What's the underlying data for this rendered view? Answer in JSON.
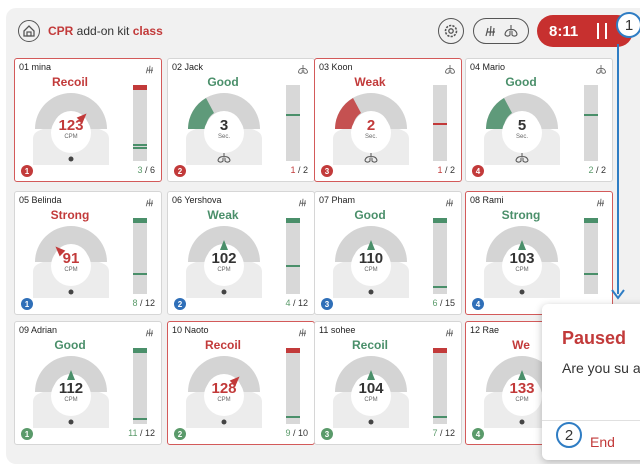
{
  "header": {
    "brand": "CPR",
    "title_mid": " add-on kit ",
    "title_class": "class",
    "timer": "8:11",
    "accent": "#c7302f"
  },
  "markers": {
    "m1": "1",
    "m2": "2"
  },
  "dialog": {
    "title": "Paused",
    "message": "Are you su and save t",
    "button": "End"
  },
  "cards": [
    {
      "name": "01 mina",
      "status": "Recoil",
      "value": "123",
      "unit": "CPM",
      "badge": "1",
      "count_a": "3",
      "count_b": "/ 6"
    },
    {
      "name": "02 Jack",
      "status": "Good",
      "value": "3",
      "unit": "Sec.",
      "badge": "2",
      "count_a": "1",
      "count_b": "/ 2"
    },
    {
      "name": "03 Koon",
      "status": "Weak",
      "value": "2",
      "unit": "Sec.",
      "badge": "3",
      "count_a": "1",
      "count_b": "/ 2"
    },
    {
      "name": "04 Mario",
      "status": "Good",
      "value": "5",
      "unit": "Sec.",
      "badge": "4",
      "count_a": "2",
      "count_b": "/ 2"
    },
    {
      "name": "05 Belinda",
      "status": "Strong",
      "value": "91",
      "unit": "CPM",
      "badge": "1",
      "count_a": "8",
      "count_b": "/ 12"
    },
    {
      "name": "06 Yershova",
      "status": "Weak",
      "value": "102",
      "unit": "CPM",
      "badge": "2",
      "count_a": "4",
      "count_b": "/ 12"
    },
    {
      "name": "07 Pham",
      "status": "Good",
      "value": "110",
      "unit": "CPM",
      "badge": "3",
      "count_a": "6",
      "count_b": "/ 15"
    },
    {
      "name": "08 Rami",
      "status": "Strong",
      "value": "103",
      "unit": "CPM",
      "badge": "4",
      "count_a": "",
      "count_b": ""
    },
    {
      "name": "09 Adrian",
      "status": "Good",
      "value": "112",
      "unit": "CPM",
      "badge": "1",
      "count_a": "11",
      "count_b": "/ 12"
    },
    {
      "name": "10 Naoto",
      "status": "Recoil",
      "value": "128",
      "unit": "CPM",
      "badge": "2",
      "count_a": "9",
      "count_b": "/ 10"
    },
    {
      "name": "11 sohee",
      "status": "Recoil",
      "value": "104",
      "unit": "CPM",
      "badge": "3",
      "count_a": "7",
      "count_b": "/ 12"
    },
    {
      "name": "12 Rae",
      "status": "We",
      "value": "133",
      "unit": "CPM",
      "badge": "4",
      "count_a": "",
      "count_b": ""
    }
  ],
  "colors": {
    "good": "#4a8f6a",
    "bad": "#c23a3a",
    "badge_blue": "#2f6fb8",
    "badge_red": "#c23a3a",
    "badge_green": "#5a9a6a"
  }
}
